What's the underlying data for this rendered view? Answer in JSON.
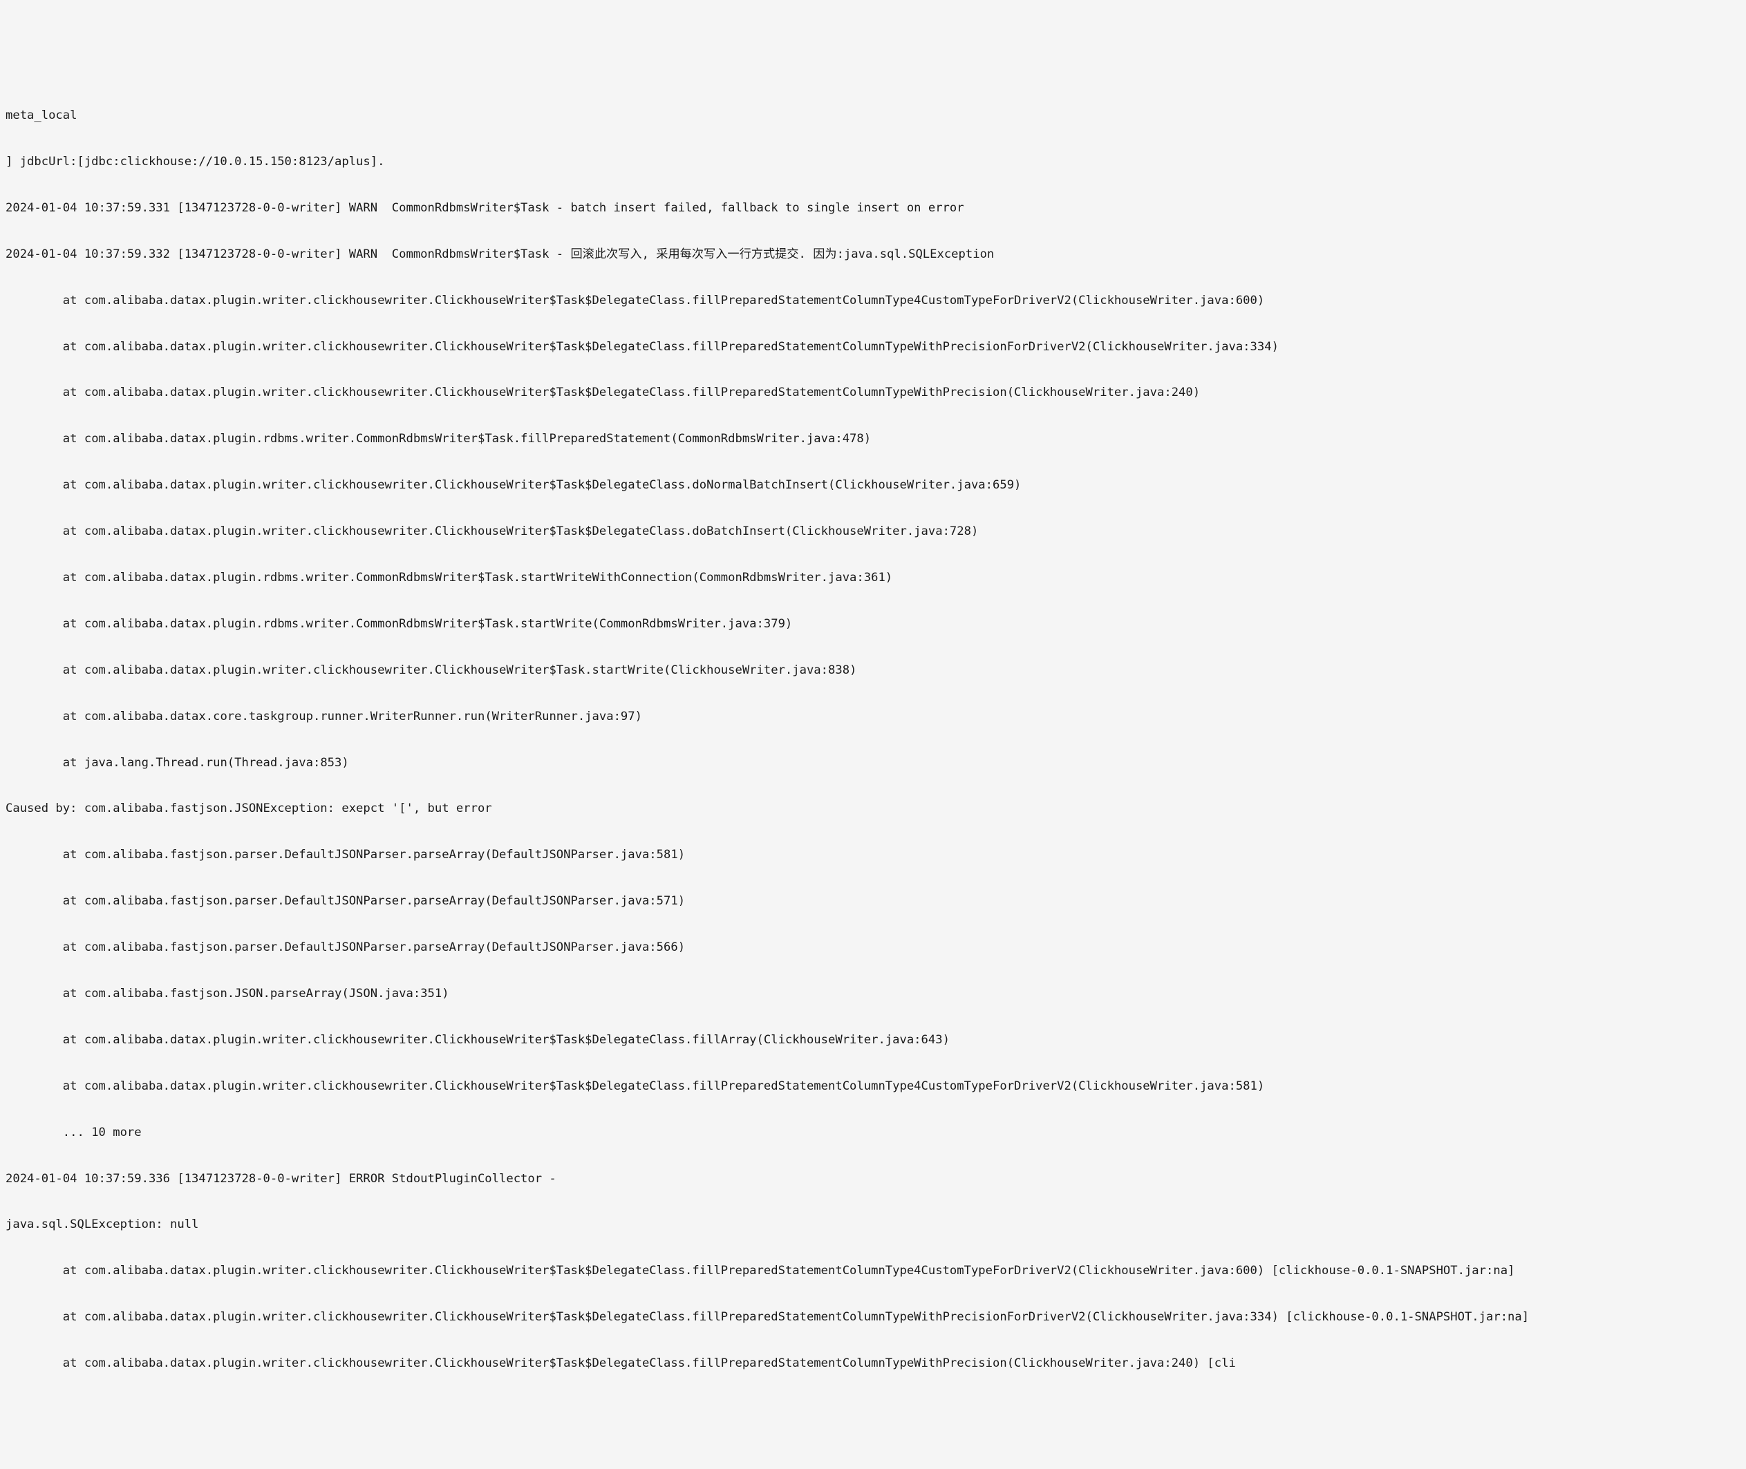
{
  "log": {
    "lines": [
      "meta_local",
      "] jdbcUrl:[jdbc:clickhouse://10.0.15.150:8123/aplus].",
      "2024-01-04 10:37:59.331 [1347123728-0-0-writer] WARN  CommonRdbmsWriter$Task - batch insert failed, fallback to single insert on error",
      "2024-01-04 10:37:59.332 [1347123728-0-0-writer] WARN  CommonRdbmsWriter$Task - 回滚此次写入, 采用每次写入一行方式提交. 因为:java.sql.SQLException",
      "        at com.alibaba.datax.plugin.writer.clickhousewriter.ClickhouseWriter$Task$DelegateClass.fillPreparedStatementColumnType4CustomTypeForDriverV2(ClickhouseWriter.java:600)",
      "        at com.alibaba.datax.plugin.writer.clickhousewriter.ClickhouseWriter$Task$DelegateClass.fillPreparedStatementColumnTypeWithPrecisionForDriverV2(ClickhouseWriter.java:334)",
      "        at com.alibaba.datax.plugin.writer.clickhousewriter.ClickhouseWriter$Task$DelegateClass.fillPreparedStatementColumnTypeWithPrecision(ClickhouseWriter.java:240)",
      "        at com.alibaba.datax.plugin.rdbms.writer.CommonRdbmsWriter$Task.fillPreparedStatement(CommonRdbmsWriter.java:478)",
      "        at com.alibaba.datax.plugin.writer.clickhousewriter.ClickhouseWriter$Task$DelegateClass.doNormalBatchInsert(ClickhouseWriter.java:659)",
      "        at com.alibaba.datax.plugin.writer.clickhousewriter.ClickhouseWriter$Task$DelegateClass.doBatchInsert(ClickhouseWriter.java:728)",
      "        at com.alibaba.datax.plugin.rdbms.writer.CommonRdbmsWriter$Task.startWriteWithConnection(CommonRdbmsWriter.java:361)",
      "        at com.alibaba.datax.plugin.rdbms.writer.CommonRdbmsWriter$Task.startWrite(CommonRdbmsWriter.java:379)",
      "        at com.alibaba.datax.plugin.writer.clickhousewriter.ClickhouseWriter$Task.startWrite(ClickhouseWriter.java:838)",
      "        at com.alibaba.datax.core.taskgroup.runner.WriterRunner.run(WriterRunner.java:97)",
      "        at java.lang.Thread.run(Thread.java:853)",
      "Caused by: com.alibaba.fastjson.JSONException: exepct '[', but error",
      "        at com.alibaba.fastjson.parser.DefaultJSONParser.parseArray(DefaultJSONParser.java:581)",
      "        at com.alibaba.fastjson.parser.DefaultJSONParser.parseArray(DefaultJSONParser.java:571)",
      "        at com.alibaba.fastjson.parser.DefaultJSONParser.parseArray(DefaultJSONParser.java:566)",
      "        at com.alibaba.fastjson.JSON.parseArray(JSON.java:351)",
      "        at com.alibaba.datax.plugin.writer.clickhousewriter.ClickhouseWriter$Task$DelegateClass.fillArray(ClickhouseWriter.java:643)",
      "        at com.alibaba.datax.plugin.writer.clickhousewriter.ClickhouseWriter$Task$DelegateClass.fillPreparedStatementColumnType4CustomTypeForDriverV2(ClickhouseWriter.java:581)",
      "        ... 10 more",
      "2024-01-04 10:37:59.336 [1347123728-0-0-writer] ERROR StdoutPluginCollector -",
      "java.sql.SQLException: null",
      "        at com.alibaba.datax.plugin.writer.clickhousewriter.ClickhouseWriter$Task$DelegateClass.fillPreparedStatementColumnType4CustomTypeForDriverV2(ClickhouseWriter.java:600) [clickhouse-0.0.1-SNAPSHOT.jar:na]",
      "        at com.alibaba.datax.plugin.writer.clickhousewriter.ClickhouseWriter$Task$DelegateClass.fillPreparedStatementColumnTypeWithPrecisionForDriverV2(ClickhouseWriter.java:334) [clickhouse-0.0.1-SNAPSHOT.jar:na]",
      "        at com.alibaba.datax.plugin.writer.clickhousewriter.ClickhouseWriter$Task$DelegateClass.fillPreparedStatementColumnTypeWithPrecision(ClickhouseWriter.java:240) [cli"
    ]
  }
}
